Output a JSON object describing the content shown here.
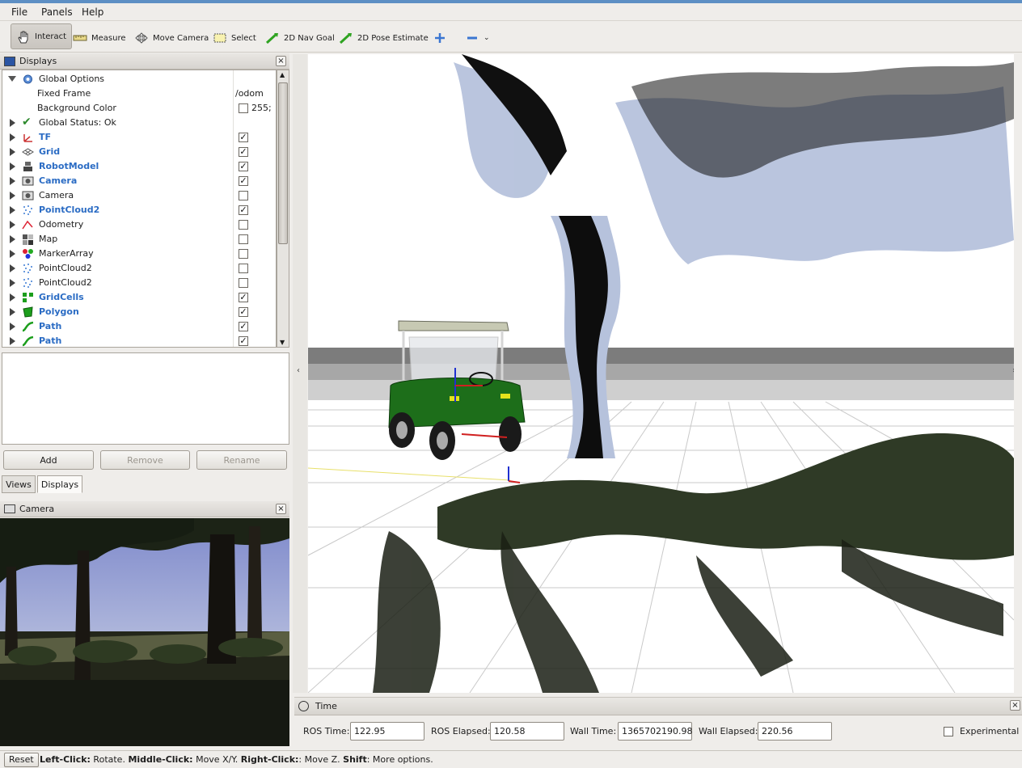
{
  "menu": [
    "File",
    "Panels",
    "Help"
  ],
  "toolbar": {
    "tools": [
      "Interact",
      "Measure",
      "Move Camera",
      "Select",
      "2D Nav Goal",
      "2D Pose Estimate"
    ]
  },
  "displays_panel": {
    "title": "Displays",
    "global_options": "Global Options",
    "fixed_frame_label": "Fixed Frame",
    "fixed_frame_value": "/odom",
    "background_color_label": "Background Color",
    "background_color_value": "255;",
    "global_status": "Global Status: Ok",
    "items": [
      {
        "label": "TF",
        "checked": true,
        "bold": true
      },
      {
        "label": "Grid",
        "checked": true,
        "bold": true
      },
      {
        "label": "RobotModel",
        "checked": true,
        "bold": true
      },
      {
        "label": "Camera",
        "checked": true,
        "bold": true
      },
      {
        "label": "Camera",
        "checked": false,
        "bold": false
      },
      {
        "label": "PointCloud2",
        "checked": true,
        "bold": true
      },
      {
        "label": "Odometry",
        "checked": false,
        "bold": false
      },
      {
        "label": "Map",
        "checked": false,
        "bold": false
      },
      {
        "label": "MarkerArray",
        "checked": false,
        "bold": false
      },
      {
        "label": "PointCloud2",
        "checked": false,
        "bold": false
      },
      {
        "label": "PointCloud2",
        "checked": false,
        "bold": false
      },
      {
        "label": "GridCells",
        "checked": true,
        "bold": true
      },
      {
        "label": "Polygon",
        "checked": true,
        "bold": true
      },
      {
        "label": "Path",
        "checked": true,
        "bold": true
      },
      {
        "label": "Path",
        "checked": true,
        "bold": true
      }
    ],
    "add": "Add",
    "remove": "Remove",
    "rename": "Rename"
  },
  "tabs": [
    "Views",
    "Displays"
  ],
  "camera_panel": {
    "title": "Camera"
  },
  "time_panel": {
    "title": "Time",
    "ros_time_label": "ROS Time:",
    "ros_time": "122.95",
    "ros_elapsed_label": "ROS Elapsed:",
    "ros_elapsed": "120.58",
    "wall_time_label": "Wall Time:",
    "wall_time": "1365702190.98",
    "wall_elapsed_label": "Wall Elapsed:",
    "wall_elapsed": "220.56",
    "experimental": "Experimental"
  },
  "status": {
    "reset": "Reset",
    "k1": "Left-Click:",
    "v1": " Rotate. ",
    "k2": "Middle-Click:",
    "v2": " Move X/Y. ",
    "k3": "Right-Click:",
    "v3": ": Move Z. ",
    "k4": "Shift",
    "v4": ": More options."
  }
}
